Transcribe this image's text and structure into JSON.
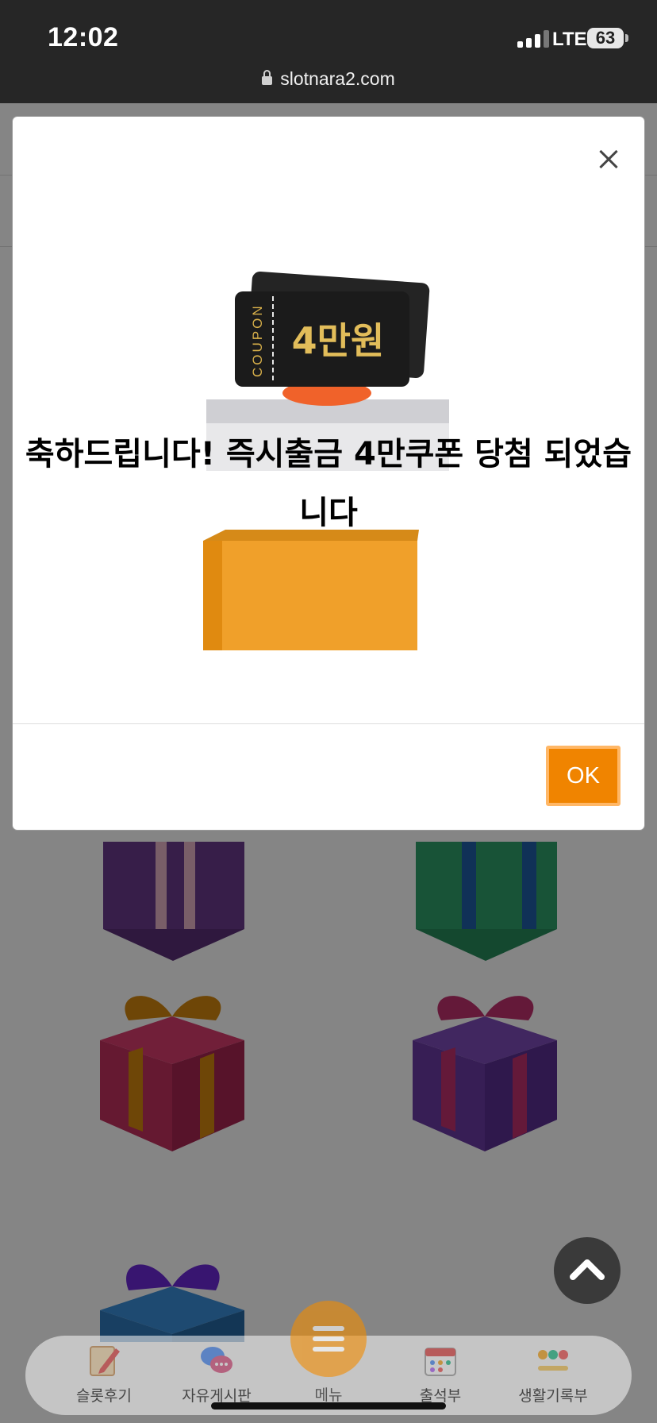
{
  "status_bar": {
    "time": "12:02",
    "network": "LTE",
    "battery": "63"
  },
  "browser": {
    "url": "slotnara2.com"
  },
  "popup": {
    "coupon_side_text": "COUPON",
    "coupon_amount": "4만원",
    "message": "축하드립니다! 즉시출금 4만쿠폰 당첨 되었습니다",
    "ok_label": "OK"
  },
  "bottom_nav": {
    "items": [
      {
        "label": "슬롯후기",
        "icon": "pencil-note-icon"
      },
      {
        "label": "자유게시판",
        "icon": "chat-bubbles-icon"
      },
      {
        "label": "메뉴",
        "icon": "hamburger-menu-icon"
      },
      {
        "label": "출석부",
        "icon": "calendar-icon"
      },
      {
        "label": "생활기록부",
        "icon": "emoji-faces-icon"
      }
    ]
  },
  "colors": {
    "accent": "#f28c00",
    "overlay": "#000000",
    "status_bar": "#262626"
  }
}
